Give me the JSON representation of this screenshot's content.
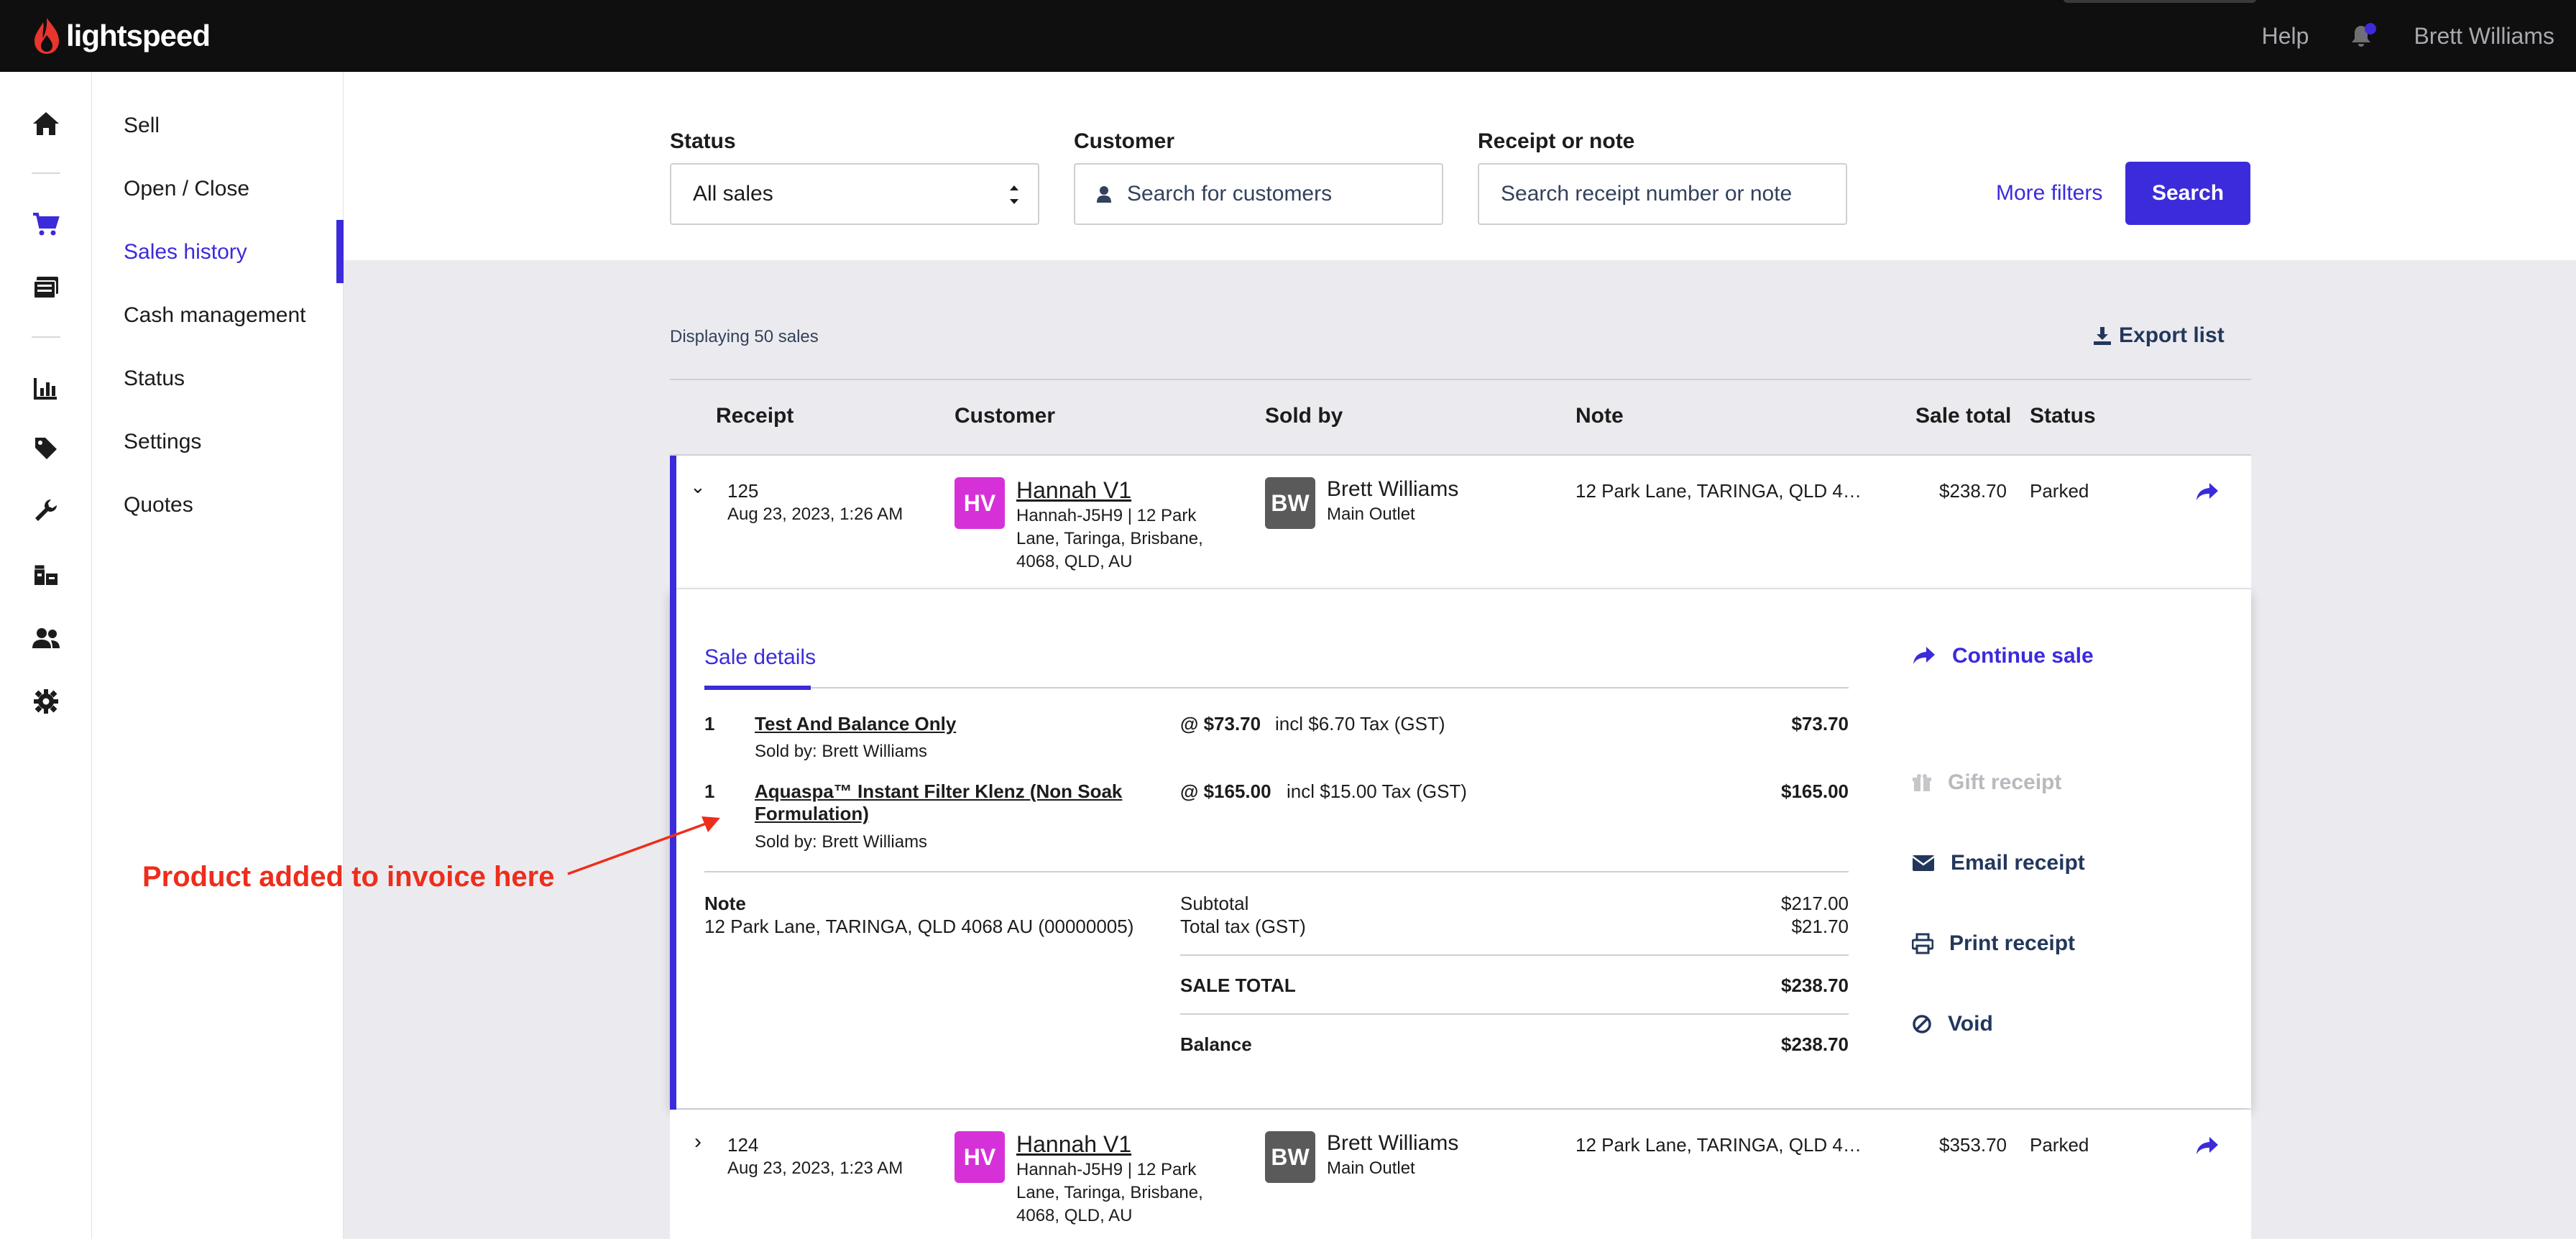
{
  "topbar": {
    "brand": "lightspeed",
    "help": "Help",
    "user": "Brett Williams"
  },
  "colors": {
    "accent": "#3c2bdb",
    "brand_red": "#e8352d",
    "annotation": "#ee2d1c",
    "avatar_hv": "#d631d9",
    "avatar_bw": "#5a5a5a"
  },
  "rail_icons": [
    "home-icon",
    "cart-icon",
    "register-icon",
    "chart-icon",
    "tag-icon",
    "wrench-icon",
    "warehouse-icon",
    "users-icon",
    "gear-icon"
  ],
  "nav": {
    "items": [
      "Sell",
      "Open / Close",
      "Sales history",
      "Cash management",
      "Status",
      "Settings",
      "Quotes"
    ],
    "active": "Sales history"
  },
  "filters": {
    "status_label": "Status",
    "status_value": "All sales",
    "customer_label": "Customer",
    "customer_placeholder": "Search for customers",
    "receipt_label": "Receipt or note",
    "receipt_placeholder": "Search receipt number or note",
    "more_filters": "More filters",
    "search": "Search"
  },
  "list": {
    "displaying": "Displaying 50 sales",
    "export": "Export list",
    "headers": [
      "Receipt",
      "Customer",
      "Sold by",
      "Note",
      "Sale total",
      "Status"
    ]
  },
  "rows": [
    {
      "receipt": "125",
      "date": "Aug 23, 2023, 1:26 AM",
      "avatar": "HV",
      "customer": "Hannah V1",
      "customer_detail": [
        "Hannah-J5H9 | 12 Park",
        "Lane, Taringa, Brisbane,",
        "4068, QLD, AU"
      ],
      "seller_avatar": "BW",
      "seller": "Brett Williams",
      "outlet": "Main Outlet",
      "note": "12 Park Lane, TARINGA, QLD 4…",
      "total": "$238.70",
      "status": "Parked",
      "chevron": "⌄"
    },
    {
      "receipt": "124",
      "date": "Aug 23, 2023, 1:23 AM",
      "avatar": "HV",
      "customer": "Hannah V1",
      "customer_detail": [
        "Hannah-J5H9 | 12 Park",
        "Lane, Taringa, Brisbane,",
        "4068, QLD, AU"
      ],
      "seller_avatar": "BW",
      "seller": "Brett Williams",
      "outlet": "Main Outlet",
      "note": "12 Park Lane, TARINGA, QLD 4…",
      "total": "$353.70",
      "status": "Parked",
      "chevron": "›"
    }
  ],
  "details": {
    "tab": "Sale details",
    "items": [
      {
        "qty": "1",
        "name": "Test And Balance Only",
        "sold_by": "Sold by: Brett Williams",
        "unit": "@ $73.70",
        "tax": "incl $6.70 Tax (GST)",
        "amount": "$73.70"
      },
      {
        "qty": "1",
        "name_line1": "Aquaspa™ Instant Filter Klenz (Non Soak",
        "name_line2": "Formulation)",
        "sold_by": "Sold by: Brett Williams",
        "unit": "@ $165.00",
        "tax": "incl $15.00 Tax (GST)",
        "amount": "$165.00"
      }
    ],
    "note_label": "Note",
    "note_value": "12 Park Lane, TARINGA, QLD 4068 AU (00000005)",
    "subtotal_label": "Subtotal",
    "subtotal": "$217.00",
    "tax_label": "Total tax (GST)",
    "tax": "$21.70",
    "sale_total_label": "SALE TOTAL",
    "sale_total": "$238.70",
    "balance_label": "Balance",
    "balance": "$238.70"
  },
  "actions": {
    "continue": "Continue sale",
    "gift": "Gift receipt",
    "email": "Email receipt",
    "print": "Print receipt",
    "void": "Void"
  },
  "annotation": "Product added to invoice here"
}
